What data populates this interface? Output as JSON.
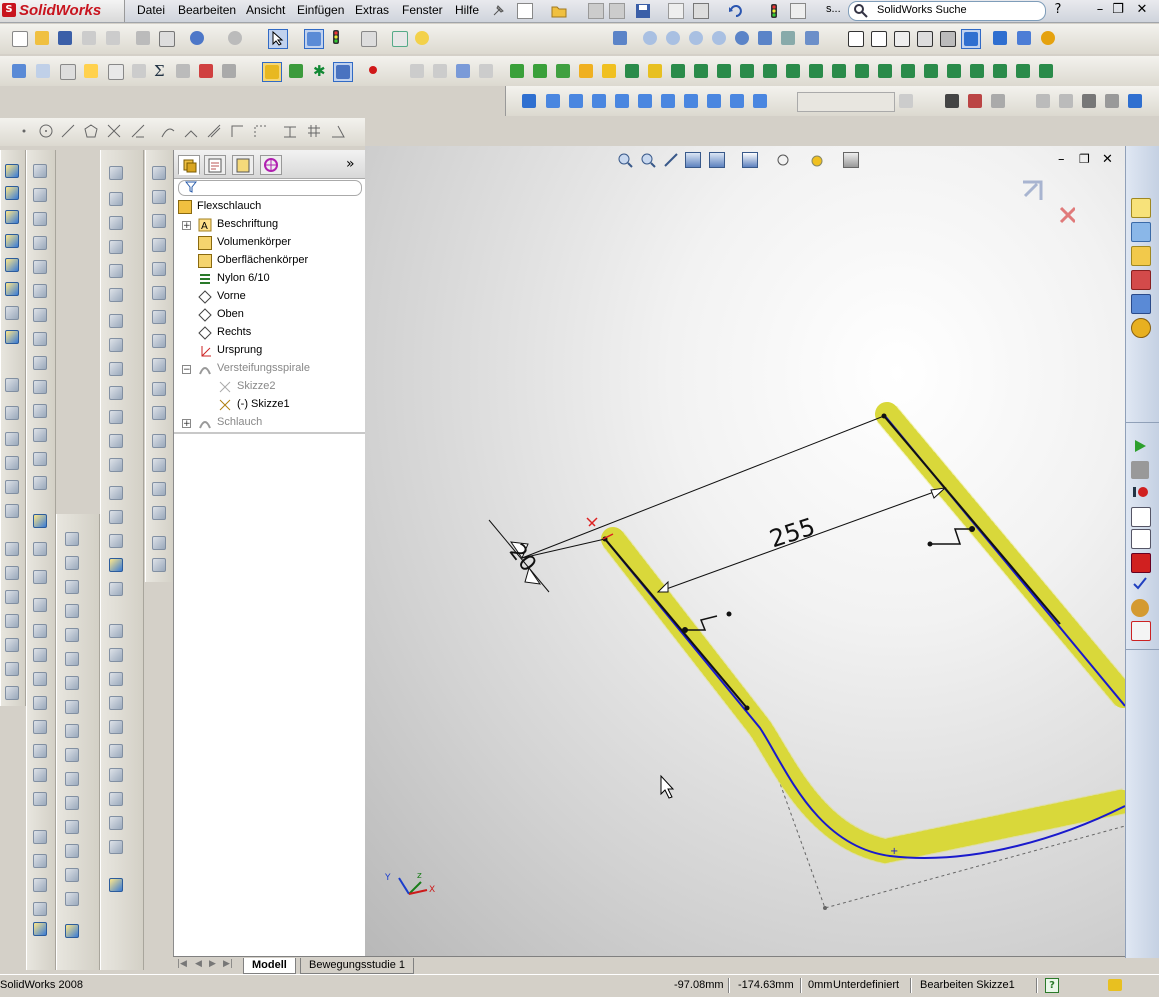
{
  "app": {
    "logo_text": "SolidWorks",
    "logo_mark": "S"
  },
  "menu": [
    "Datei",
    "Bearbeiten",
    "Ansicht",
    "Einfügen",
    "Extras",
    "Fenster",
    "Hilfe"
  ],
  "search": {
    "placeholder": "SolidWorks Suche",
    "ellipsis": "s..."
  },
  "window_controls": {
    "help": "?",
    "minimize": "–",
    "restore": "❐",
    "close": "✕"
  },
  "viewport_window_controls": {
    "minimize": "–",
    "restore": "❐",
    "close": "✕"
  },
  "feature_tree": {
    "collapse_arrow": "»",
    "items": [
      {
        "label": "Flexschlauch",
        "icon": "part-icon",
        "dimmed": false,
        "expander": ""
      },
      {
        "label": "Beschriftung",
        "icon": "annotation-icon",
        "dimmed": false,
        "expander": "+"
      },
      {
        "label": "Volumenkörper",
        "icon": "solid-bodies-icon",
        "dimmed": false,
        "expander": ""
      },
      {
        "label": "Oberflächenkörper",
        "icon": "surface-bodies-icon",
        "dimmed": false,
        "expander": ""
      },
      {
        "label": "Nylon 6/10",
        "icon": "material-icon",
        "dimmed": false,
        "expander": ""
      },
      {
        "label": "Vorne",
        "icon": "plane-icon",
        "dimmed": false,
        "expander": ""
      },
      {
        "label": "Oben",
        "icon": "plane-icon",
        "dimmed": false,
        "expander": ""
      },
      {
        "label": "Rechts",
        "icon": "plane-icon",
        "dimmed": false,
        "expander": ""
      },
      {
        "label": "Ursprung",
        "icon": "origin-icon",
        "dimmed": false,
        "expander": ""
      },
      {
        "label": "Versteifungsspirale",
        "icon": "sweep-feature-icon",
        "dimmed": true,
        "expander": "−"
      },
      {
        "label": "Skizze2",
        "icon": "sketch-icon",
        "dimmed": true,
        "expander": ""
      },
      {
        "label": "(-) Skizze1",
        "icon": "sketch-icon",
        "dimmed": false,
        "expander": ""
      },
      {
        "label": "Schlauch",
        "icon": "sweep-feature-icon",
        "dimmed": true,
        "expander": "+"
      }
    ]
  },
  "dimensions": {
    "length": "255",
    "width": "20"
  },
  "bottom_tabs": {
    "nav": [
      "|◀",
      "◀",
      "▶",
      "▶|"
    ],
    "active": "Modell",
    "other": "Bewegungsstudie 1"
  },
  "status": {
    "version": "SolidWorks 2008",
    "x": "-97.08mm",
    "y": "-174.63mm",
    "z": "0mm",
    "state": "Unterdefiniert",
    "mode": "Bearbeiten Skizze1",
    "help": "?"
  },
  "colors": {
    "path": "#1a1acc",
    "spring": "#e3e24a",
    "accent": "#c8141e"
  }
}
